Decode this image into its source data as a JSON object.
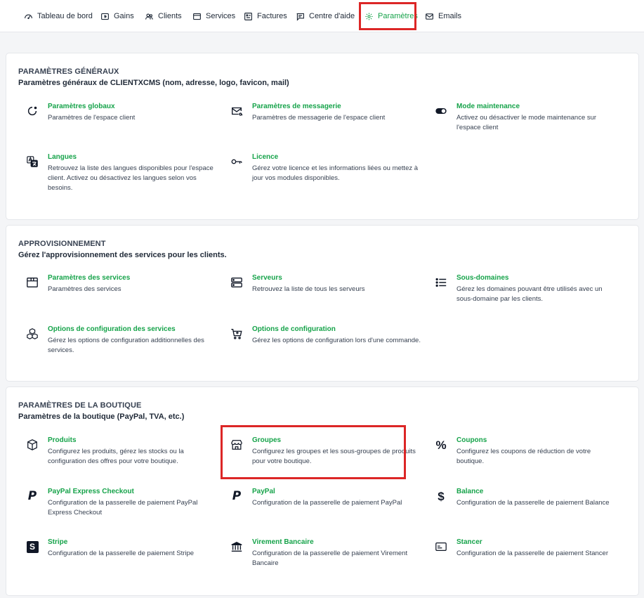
{
  "nav": {
    "items": [
      {
        "label": "Tableau de bord",
        "icon": "dashboard-icon"
      },
      {
        "label": "Gains",
        "icon": "gains-icon"
      },
      {
        "label": "Clients",
        "icon": "users-icon"
      },
      {
        "label": "Services",
        "icon": "box-icon"
      },
      {
        "label": "Factures",
        "icon": "invoice-icon"
      },
      {
        "label": "Centre d'aide",
        "icon": "help-chat-icon"
      },
      {
        "label": "Paramètres",
        "icon": "gear-icon"
      },
      {
        "label": "Emails",
        "icon": "mail-icon"
      }
    ],
    "active": "Paramètres",
    "accent": "#16a34a"
  },
  "sections": [
    {
      "title": "PARAMÈTRES GÉNÉRAUX",
      "subtitle": "Paramètres généraux de CLIENTXCMS (nom, adresse, logo, favicon, mail)",
      "items": [
        {
          "title": "Paramètres globaux",
          "desc": "Paramètres de l'espace client",
          "icon": "circle-dot-icon"
        },
        {
          "title": "Paramètres de messagerie",
          "desc": "Paramètres de messagerie de l'espace client",
          "icon": "mail-at-icon"
        },
        {
          "title": "Mode maintenance",
          "desc": "Activez ou désactiver le mode maintenance sur l'espace client",
          "icon": "toggle-icon"
        },
        {
          "title": "Langues",
          "desc": "Retrouvez la liste des langues disponibles pour l'espace client. Activez ou désactivez les langues selon vos besoins.",
          "icon": "translate-icon"
        },
        {
          "title": "Licence",
          "desc": "Gérez votre licence et les informations liées ou mettez à jour vos modules disponibles.",
          "icon": "key-icon"
        }
      ]
    },
    {
      "title": "APPROVISIONNEMENT",
      "subtitle": "Gérez l'approvisionnement des services pour les clients.",
      "items": [
        {
          "title": "Paramètres des services",
          "desc": "Paramètres des services",
          "icon": "box-icon"
        },
        {
          "title": "Serveurs",
          "desc": "Retrouvez la liste de tous les serveurs",
          "icon": "server-icon"
        },
        {
          "title": "Sous-domaines",
          "desc": "Gérez les domaines pouvant être utilisés avec un sous-domaine par les clients.",
          "icon": "list-icon"
        },
        {
          "title": "Options de configuration des services",
          "desc": "Gérez les options de configuration additionnelles des services.",
          "icon": "boxes-icon"
        },
        {
          "title": "Options de configuration",
          "desc": "Gérez les options de configuration lors d'une commande.",
          "icon": "cart-plus-icon"
        }
      ]
    },
    {
      "title": "PARAMÈTRES DE LA BOUTIQUE",
      "subtitle": "Paramètres de la boutique (PayPal, TVA, etc.)",
      "items": [
        {
          "title": "Produits",
          "desc": "Configurez les produits, gérez les stocks ou la configuration des offres pour votre boutique.",
          "icon": "cube-icon"
        },
        {
          "title": "Groupes",
          "desc": "Configurez les groupes et les sous-groupes de produits pour votre boutique.",
          "icon": "shop-icon"
        },
        {
          "title": "Coupons",
          "desc": "Configurez les coupons de réduction de votre boutique.",
          "icon": "percent-icon"
        },
        {
          "title": "PayPal Express Checkout",
          "desc": "Configuration de la passerelle de paiement PayPal Express Checkout",
          "icon": "paypal-icon"
        },
        {
          "title": "PayPal",
          "desc": "Configuration de la passerelle de paiement PayPal",
          "icon": "paypal-icon"
        },
        {
          "title": "Balance",
          "desc": "Configuration de la passerelle de paiement Balance",
          "icon": "dollar-icon"
        },
        {
          "title": "Stripe",
          "desc": "Configuration de la passerelle de paiement Stripe",
          "icon": "stripe-icon"
        },
        {
          "title": "Virement Bancaire",
          "desc": "Configuration de la passerelle de paiement Virement Bancaire",
          "icon": "bank-icon"
        },
        {
          "title": "Stancer",
          "desc": "Configuration de la passerelle de paiement Stancer",
          "icon": "card-icon"
        }
      ]
    }
  ],
  "glyphs": {
    "percent": "%",
    "dollar": "$",
    "paypal": "P",
    "stripe": "S"
  }
}
